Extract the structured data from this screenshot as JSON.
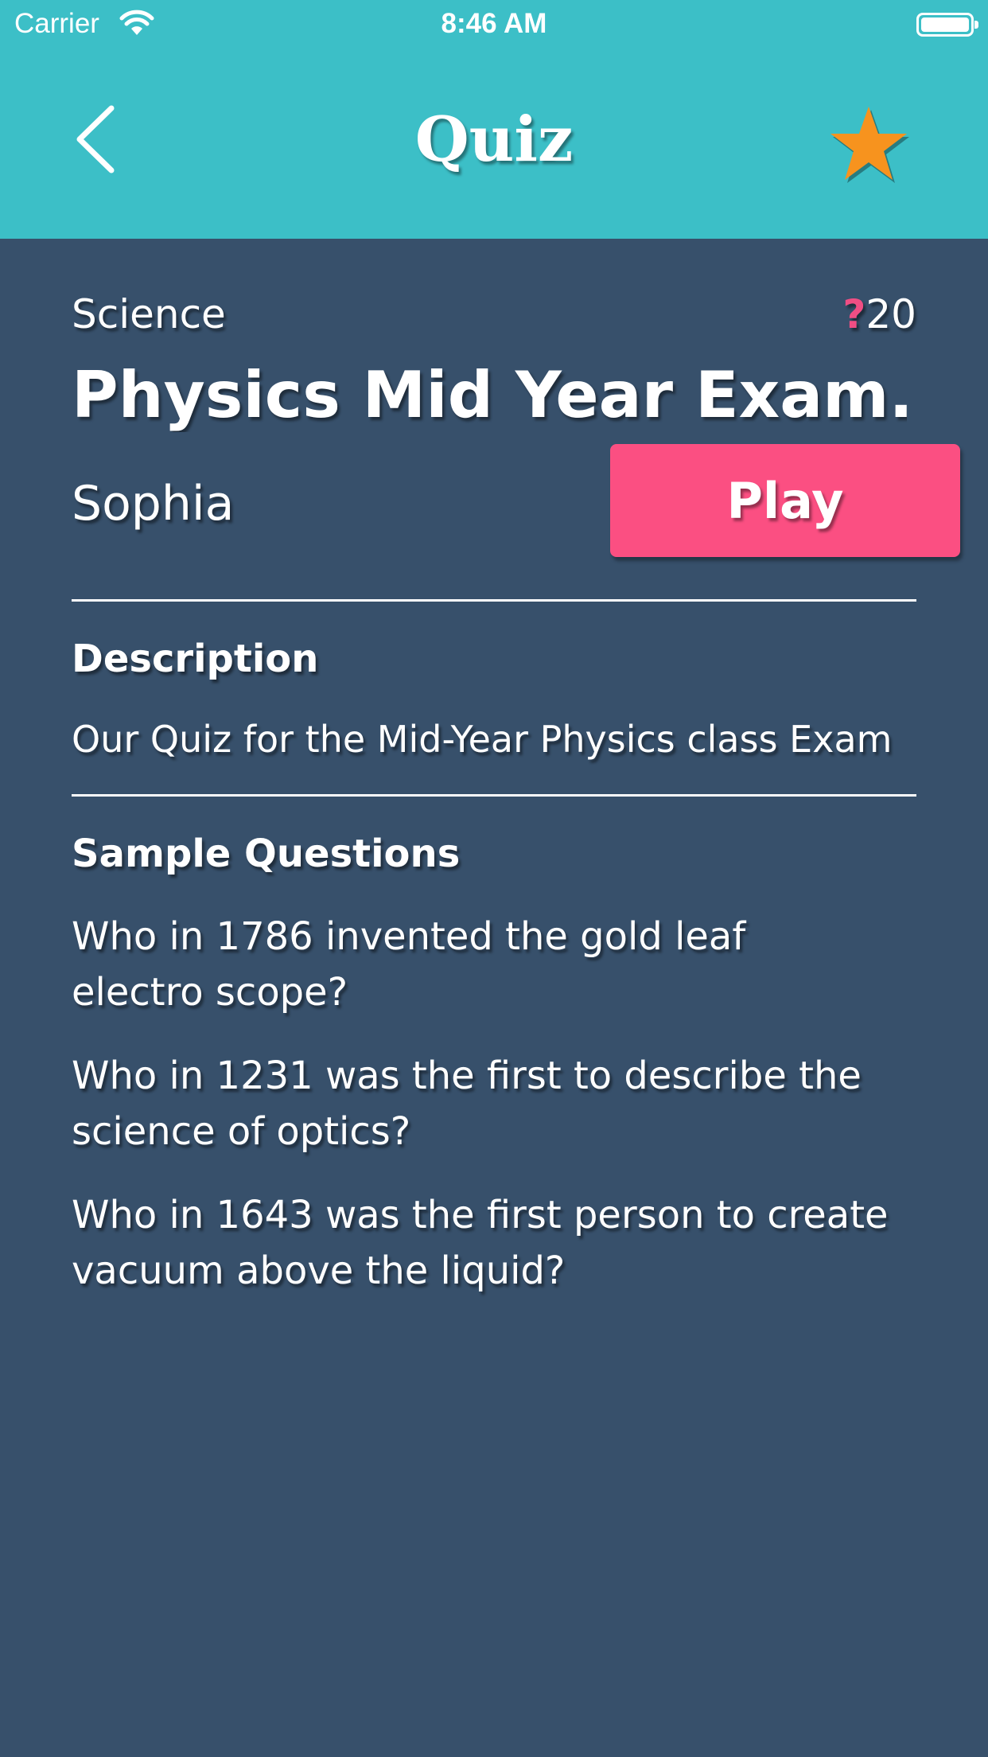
{
  "status_bar": {
    "carrier": "Carrier",
    "time": "8:46 AM"
  },
  "nav": {
    "title": "Quiz",
    "back_icon": "chevron-left-icon",
    "favorite_icon": "star-icon",
    "favorite_color": "#f7931e"
  },
  "quiz": {
    "category": "Science",
    "question_mark": "?",
    "question_count": "20",
    "title": "Physics Mid Year Exam...",
    "author": "Sophia",
    "play_label": "Play"
  },
  "description": {
    "heading": "Description",
    "text": "Our Quiz for the Mid-Year Physics class Exam"
  },
  "sample_questions": {
    "heading": "Sample Questions",
    "items": [
      "Who in 1786 invented the gold leaf electro scope?",
      "Who in 1231 was the first to describe the science of optics?",
      "Who in 1643 was the first person to create vacuum above the liquid?"
    ]
  },
  "colors": {
    "header_bg": "#3cbfc7",
    "body_bg": "#37506b",
    "accent": "#fb4f82"
  }
}
